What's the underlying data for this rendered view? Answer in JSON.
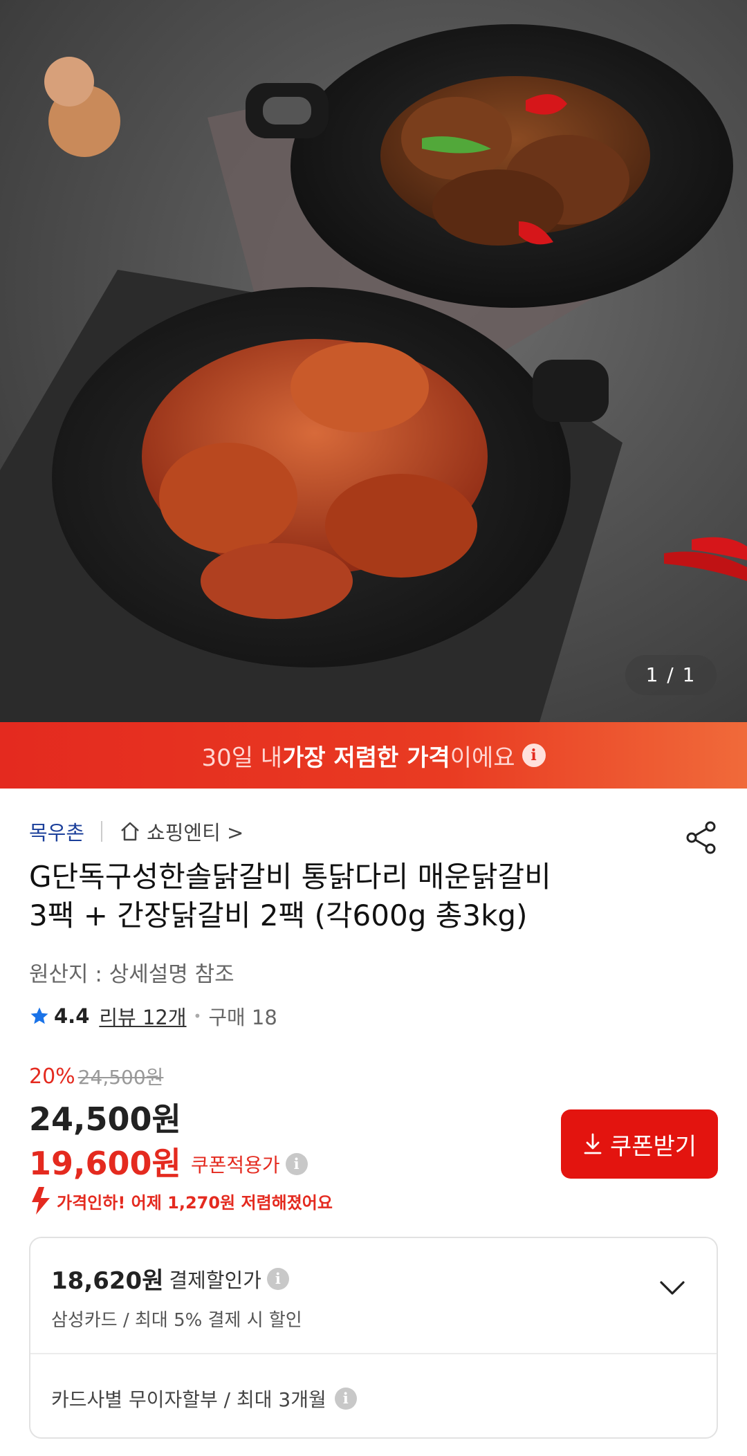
{
  "hero": {
    "page_indicator": "1 / 1"
  },
  "banner": {
    "text_before": "30일 내 ",
    "text_bold": "가장 저렴한 가격",
    "text_after": "이에요",
    "info_icon": "info-icon"
  },
  "seller": {
    "name": "목우촌",
    "store_link": "쇼핑엔티 >"
  },
  "product": {
    "title_line1": "G단독구성한솔닭갈비 통닭다리 매운닭갈비",
    "title_line2": "3팩 + 간장닭갈비 2팩 (각600g 총3kg)",
    "origin": "원산지 : 상세설명 참조"
  },
  "rating": {
    "score": "4.4",
    "reviews": "리뷰 12개",
    "purchases": "구매 18"
  },
  "price": {
    "discount_pct": "20%",
    "original": "24,500원",
    "sale": "24,500원",
    "coupon_price": "19,600원",
    "coupon_label": "쿠폰적용가",
    "coupon_button": "쿠폰받기",
    "price_drop": "가격인하! 어제 1,270원 저렴해졌어요"
  },
  "payment_card": {
    "price": "18,620원",
    "label": "결제할인가",
    "sub": "삼성카드 / 최대 5% 결제 시 할인",
    "installment": "카드사별 무이자할부 / 최대 3개월"
  },
  "colors": {
    "accent_red": "#e42a1f",
    "seller_blue": "#1b3f9a",
    "star_blue": "#1a73e8"
  }
}
